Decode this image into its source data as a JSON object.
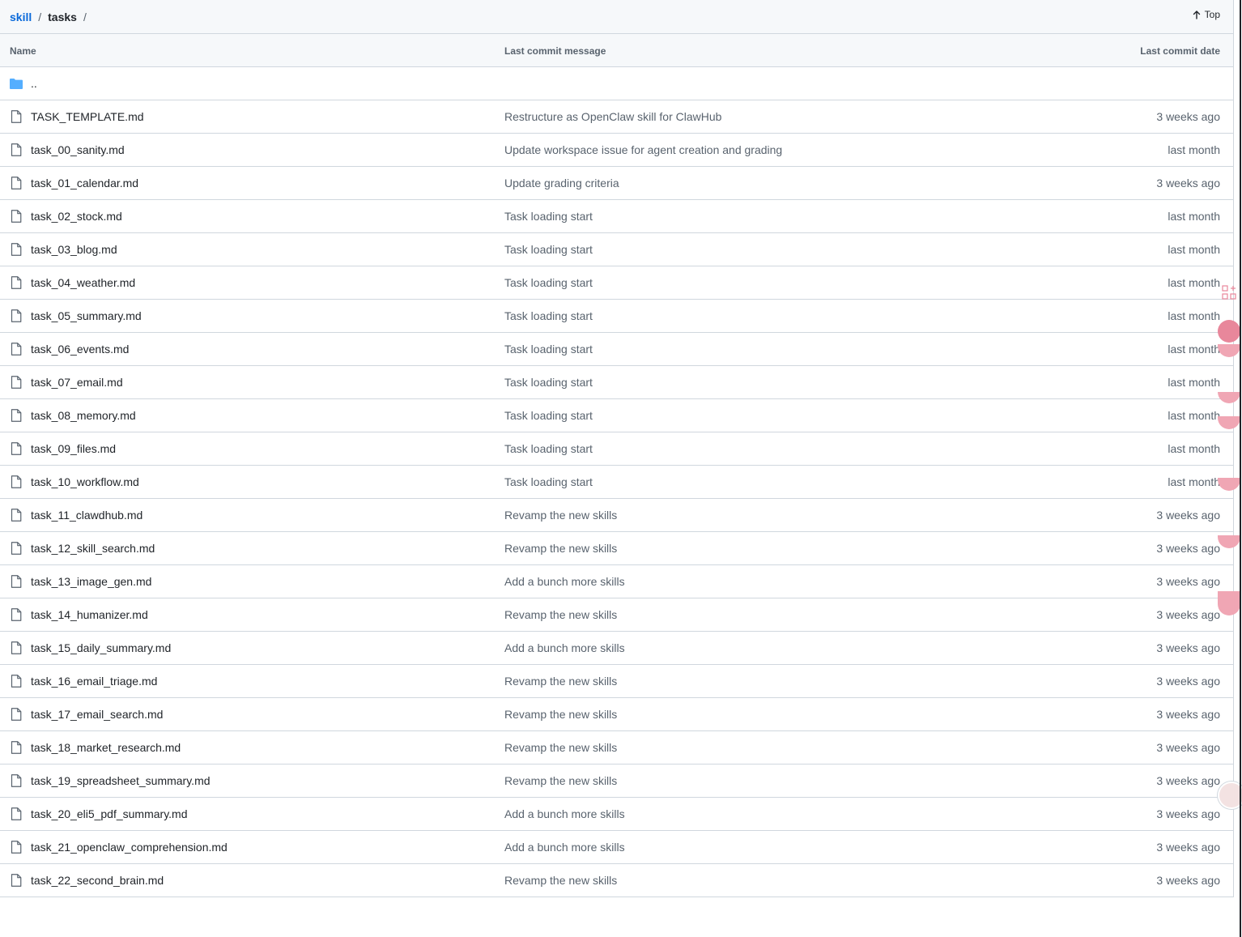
{
  "breadcrumb": {
    "root": "skill",
    "separator": "/",
    "current": "tasks"
  },
  "top_button": {
    "label": "Top"
  },
  "columns": {
    "name": "Name",
    "message": "Last commit message",
    "date": "Last commit date"
  },
  "parent_dir": "..",
  "files": [
    {
      "name": "TASK_TEMPLATE.md",
      "message": "Restructure as OpenClaw skill for ClawHub",
      "date": "3 weeks ago"
    },
    {
      "name": "task_00_sanity.md",
      "message": "Update workspace issue for agent creation and grading",
      "date": "last month"
    },
    {
      "name": "task_01_calendar.md",
      "message": "Update grading criteria",
      "date": "3 weeks ago"
    },
    {
      "name": "task_02_stock.md",
      "message": "Task loading start",
      "date": "last month"
    },
    {
      "name": "task_03_blog.md",
      "message": "Task loading start",
      "date": "last month"
    },
    {
      "name": "task_04_weather.md",
      "message": "Task loading start",
      "date": "last month"
    },
    {
      "name": "task_05_summary.md",
      "message": "Task loading start",
      "date": "last month"
    },
    {
      "name": "task_06_events.md",
      "message": "Task loading start",
      "date": "last month"
    },
    {
      "name": "task_07_email.md",
      "message": "Task loading start",
      "date": "last month"
    },
    {
      "name": "task_08_memory.md",
      "message": "Task loading start",
      "date": "last month"
    },
    {
      "name": "task_09_files.md",
      "message": "Task loading start",
      "date": "last month"
    },
    {
      "name": "task_10_workflow.md",
      "message": "Task loading start",
      "date": "last month"
    },
    {
      "name": "task_11_clawdhub.md",
      "message": "Revamp the new skills",
      "date": "3 weeks ago"
    },
    {
      "name": "task_12_skill_search.md",
      "message": "Revamp the new skills",
      "date": "3 weeks ago"
    },
    {
      "name": "task_13_image_gen.md",
      "message": "Add a bunch more skills",
      "date": "3 weeks ago"
    },
    {
      "name": "task_14_humanizer.md",
      "message": "Revamp the new skills",
      "date": "3 weeks ago"
    },
    {
      "name": "task_15_daily_summary.md",
      "message": "Add a bunch more skills",
      "date": "3 weeks ago"
    },
    {
      "name": "task_16_email_triage.md",
      "message": "Revamp the new skills",
      "date": "3 weeks ago"
    },
    {
      "name": "task_17_email_search.md",
      "message": "Revamp the new skills",
      "date": "3 weeks ago"
    },
    {
      "name": "task_18_market_research.md",
      "message": "Revamp the new skills",
      "date": "3 weeks ago"
    },
    {
      "name": "task_19_spreadsheet_summary.md",
      "message": "Revamp the new skills",
      "date": "3 weeks ago"
    },
    {
      "name": "task_20_eli5_pdf_summary.md",
      "message": "Add a bunch more skills",
      "date": "3 weeks ago"
    },
    {
      "name": "task_21_openclaw_comprehension.md",
      "message": "Add a bunch more skills",
      "date": "3 weeks ago"
    },
    {
      "name": "task_22_second_brain.md",
      "message": "Revamp the new skills",
      "date": "3 weeks ago"
    }
  ],
  "colors": {
    "link": "#0969da",
    "folder": "#54aeff",
    "muted": "#59636e",
    "border": "#d0d7de",
    "header_bg": "#f6f8fa",
    "side_widget": "#e8879b"
  },
  "icons": {
    "file": "file-icon",
    "folder": "folder-icon",
    "top": "arrow-up-icon"
  }
}
